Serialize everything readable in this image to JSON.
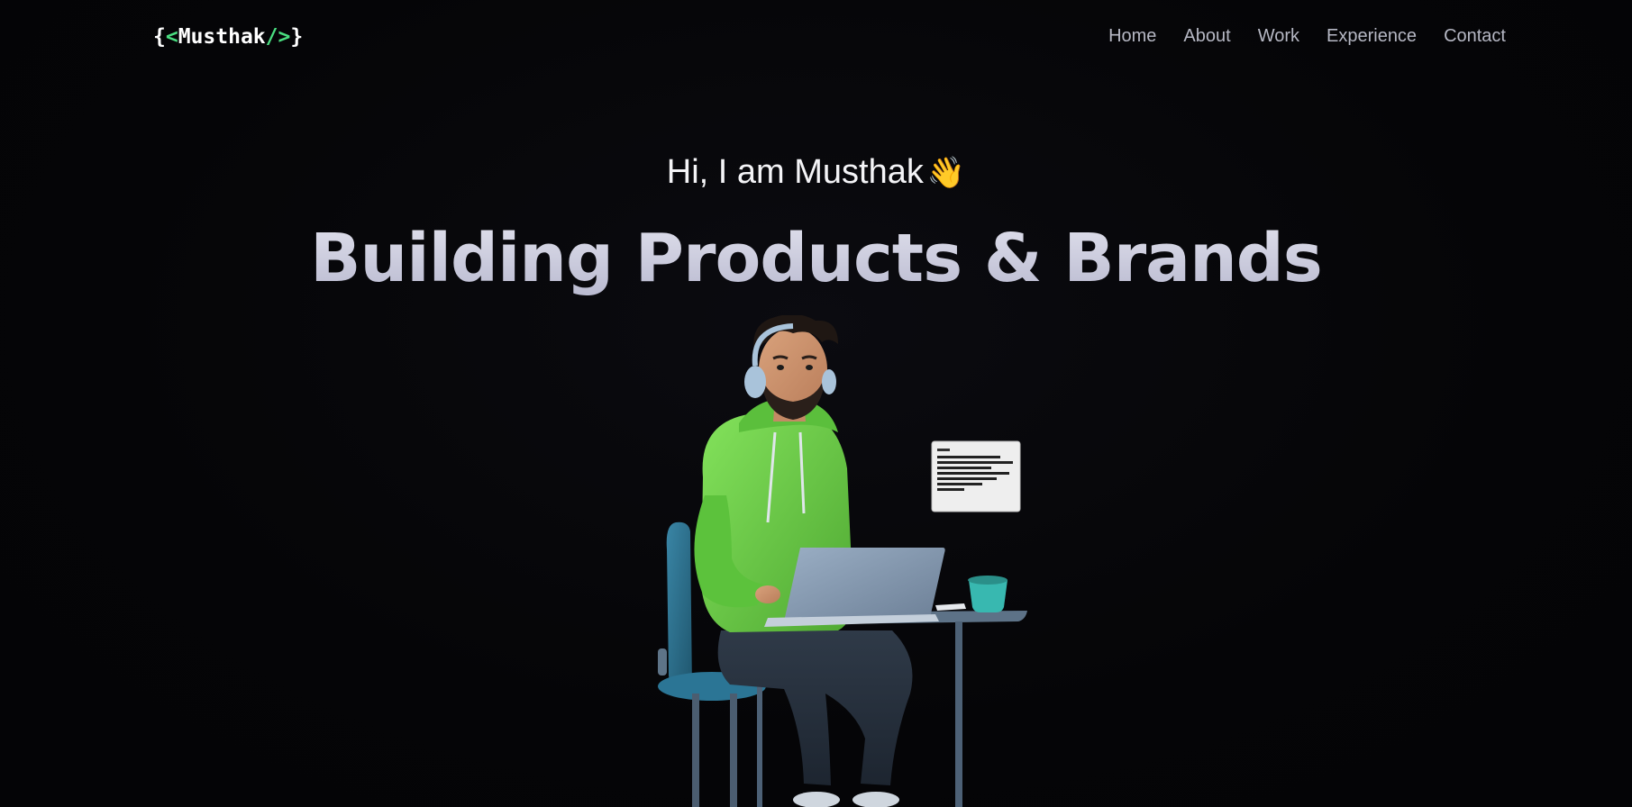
{
  "header": {
    "logo": {
      "open_brace": "{",
      "open_tag": "<",
      "name": "Musthak",
      "close_tag": "/>",
      "close_brace": "}"
    },
    "nav": [
      {
        "label": "Home"
      },
      {
        "label": "About"
      },
      {
        "label": "Work"
      },
      {
        "label": "Experience"
      },
      {
        "label": "Contact"
      }
    ]
  },
  "hero": {
    "greeting": "Hi, I am Musthak",
    "wave_emoji": "👋",
    "headline": "Building Products & Brands"
  },
  "illustration": {
    "subject": "developer-avatar-icon"
  },
  "colors": {
    "background": "#050507",
    "accent": "#4ade80",
    "nav_text": "#b6b8c4",
    "headline": "#c8c9dc",
    "hoodie": "#6ccf4a",
    "chair": "#2f6f8a"
  }
}
